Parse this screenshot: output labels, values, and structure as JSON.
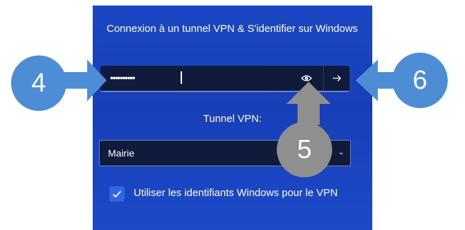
{
  "dialog": {
    "heading": "Connexion à un tunnel VPN & S'identifier sur Windows",
    "password": {
      "value": "••••••••••",
      "reveal_icon": "eye-icon",
      "submit_icon": "arrow-right-icon"
    },
    "tunnel": {
      "label": "Tunnel VPN:",
      "selected": "Mairie"
    },
    "checkbox": {
      "checked": true,
      "label": "Utiliser les identifiants Windows pour le VPN"
    }
  },
  "callouts": [
    {
      "number": "4",
      "color": "#4c8dd6"
    },
    {
      "number": "5",
      "color": "#8f8f8f"
    },
    {
      "number": "6",
      "color": "#4c8dd6"
    }
  ]
}
